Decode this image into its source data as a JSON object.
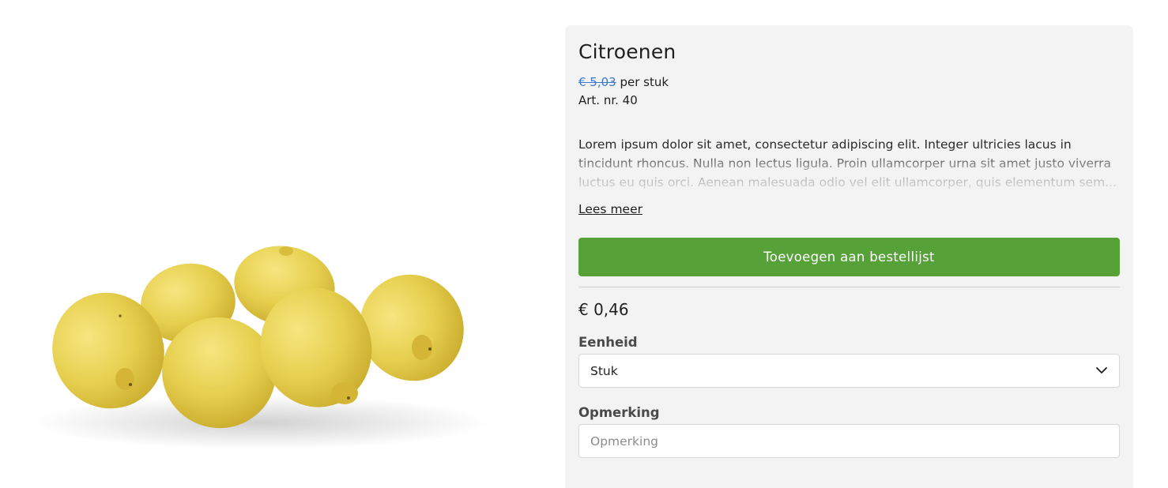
{
  "product": {
    "title": "Citroenen",
    "old_price": "€ 5,03",
    "per_unit": "per stuk",
    "article_number": "Art. nr. 40",
    "description": "Lorem ipsum dolor sit amet, consectetur adipiscing elit. Integer ultricies lacus in tincidunt rhoncus. Nulla non lectus ligula. Proin ullamcorper urna sit amet justo viverra luctus eu quis orci. Aenean malesuada odio vel elit ullamcorper, quis elementum sem...",
    "read_more_label": "Lees meer",
    "add_button_label": "Toevoegen aan bestellijst",
    "unit_price": "€ 0,46"
  },
  "form": {
    "unit_label": "Eenheid",
    "unit_value": "Stuk",
    "remark_label": "Opmerking",
    "remark_placeholder": "Opmerking",
    "remark_value": ""
  },
  "colors": {
    "accent_green": "#57a238",
    "old_price_blue": "#3a78c9",
    "card_background": "#f3f3f3",
    "lemon_yellow": "#e6cf4e"
  },
  "icons": {
    "unit_dropdown": "chevron-down-icon"
  }
}
